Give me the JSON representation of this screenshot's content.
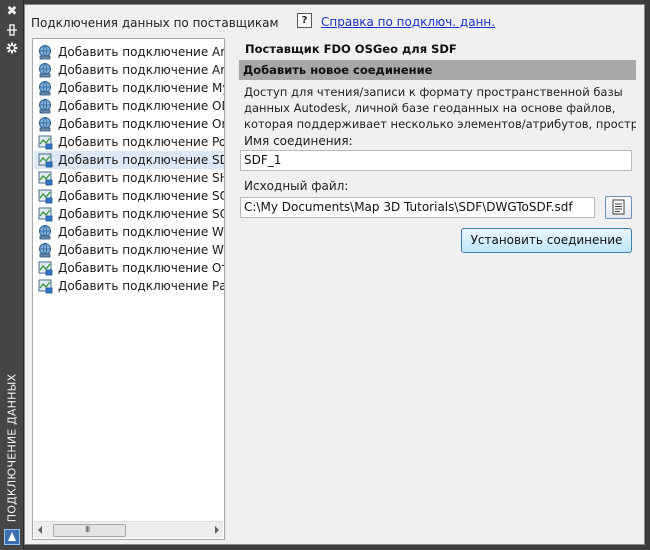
{
  "palette": {
    "background": "#f0f0f0",
    "titlebar": "#454545",
    "section_bar": "#a8a8a8",
    "link": "#1a33c8",
    "selected_row": "#dde8f5"
  },
  "titlebar": {
    "vertical_title": "ПОДКЛЮЧЕНИЕ ДАННЫХ",
    "close_glyph": "✖",
    "autohide_glyph": "▮",
    "settings_glyph": "✱"
  },
  "header": {
    "label": "Подключения данных по поставщикам",
    "help_icon_glyph": "?",
    "help_link": "Справка по подключ. данн."
  },
  "providers": [
    {
      "label": "Добавить подключение ArcGIS",
      "icon": "arcgis-icon",
      "selected": false
    },
    {
      "label": "Добавить подключение ArcSDE",
      "icon": "arcsde-icon",
      "selected": false
    },
    {
      "label": "Добавить подключение MySQL",
      "icon": "mysql-icon",
      "selected": false
    },
    {
      "label": "Добавить подключение ODBC",
      "icon": "odbc-icon",
      "selected": false
    },
    {
      "label": "Добавить подключение Oracle",
      "icon": "oracle-icon",
      "selected": false
    },
    {
      "label": "Добавить подключение PostgreSQL",
      "icon": "postgresql-icon",
      "selected": false
    },
    {
      "label": "Добавить подключение SDF",
      "icon": "sdf-icon",
      "selected": true
    },
    {
      "label": "Добавить подключение SHP",
      "icon": "shp-icon",
      "selected": false
    },
    {
      "label": "Добавить подключение SQL Server",
      "icon": "sqlserver-icon",
      "selected": false
    },
    {
      "label": "Добавить подключение SQLite",
      "icon": "sqlite-icon",
      "selected": false
    },
    {
      "label": "Добавить подключение WFS",
      "icon": "wfs-icon",
      "selected": false
    },
    {
      "label": "Добавить подключение WMS",
      "icon": "wms-icon",
      "selected": false
    },
    {
      "label": "Добавить подключение Отрасль",
      "icon": "industry-icon",
      "selected": false
    },
    {
      "label": "Добавить подключение Растр",
      "icon": "raster-icon",
      "selected": false
    }
  ],
  "list_scrollbar": {
    "grip_glyph": "III"
  },
  "panel": {
    "provider_title": "Поставщик FDO OSGeo для SDF",
    "section_title": "Добавить новое соединение",
    "description_lines": [
      "Доступ для чтения/записи к формату пространственной базы",
      "данных Autodesk, личной базе геоданных на основе файлов,",
      "которая  поддерживает  несколько элементов/атрибутов, пространс"
    ],
    "connection_name_label": "Имя соединения:",
    "connection_name_value": "SDF_1",
    "source_file_label": "Исходный файл:",
    "source_file_value": "C:\\My Documents\\Map 3D Tutorials\\SDF\\DWGToSDF.sdf",
    "connect_button": "Установить соединение"
  }
}
